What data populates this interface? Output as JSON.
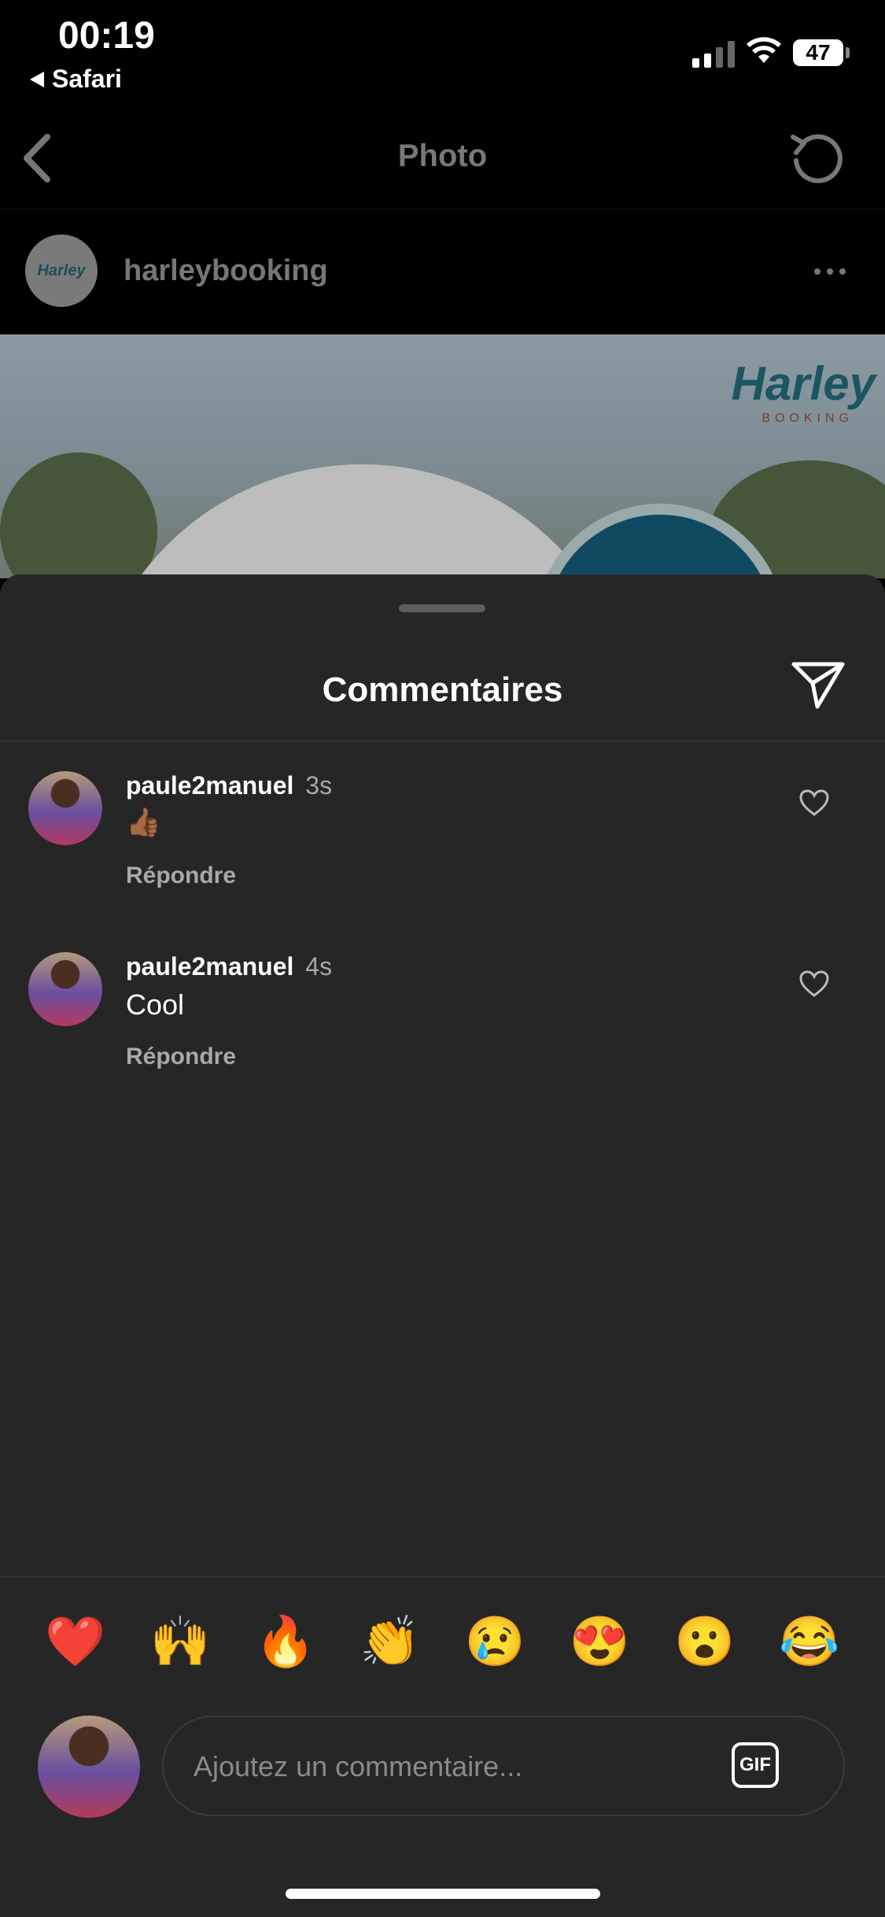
{
  "status_bar": {
    "time": "00:19",
    "back_app": "Safari",
    "battery": "47"
  },
  "nav": {
    "title": "Photo"
  },
  "post": {
    "avatar_text": "Harley",
    "username": "harleybooking",
    "brand": "Harley",
    "brand_sub": "BOOKING"
  },
  "comments_sheet": {
    "title": "Commentaires",
    "comments": [
      {
        "user": "paule2manuel",
        "time": "3s",
        "text": "👍🏾",
        "reply": "Répondre"
      },
      {
        "user": "paule2manuel",
        "time": "4s",
        "text": "Cool",
        "reply": "Répondre"
      }
    ],
    "quick_emojis": [
      "❤️",
      "🙌",
      "🔥",
      "👏",
      "😢",
      "😍",
      "😮",
      "😂"
    ],
    "compose": {
      "placeholder": "Ajoutez un commentaire...",
      "gif_label": "GIF"
    }
  }
}
